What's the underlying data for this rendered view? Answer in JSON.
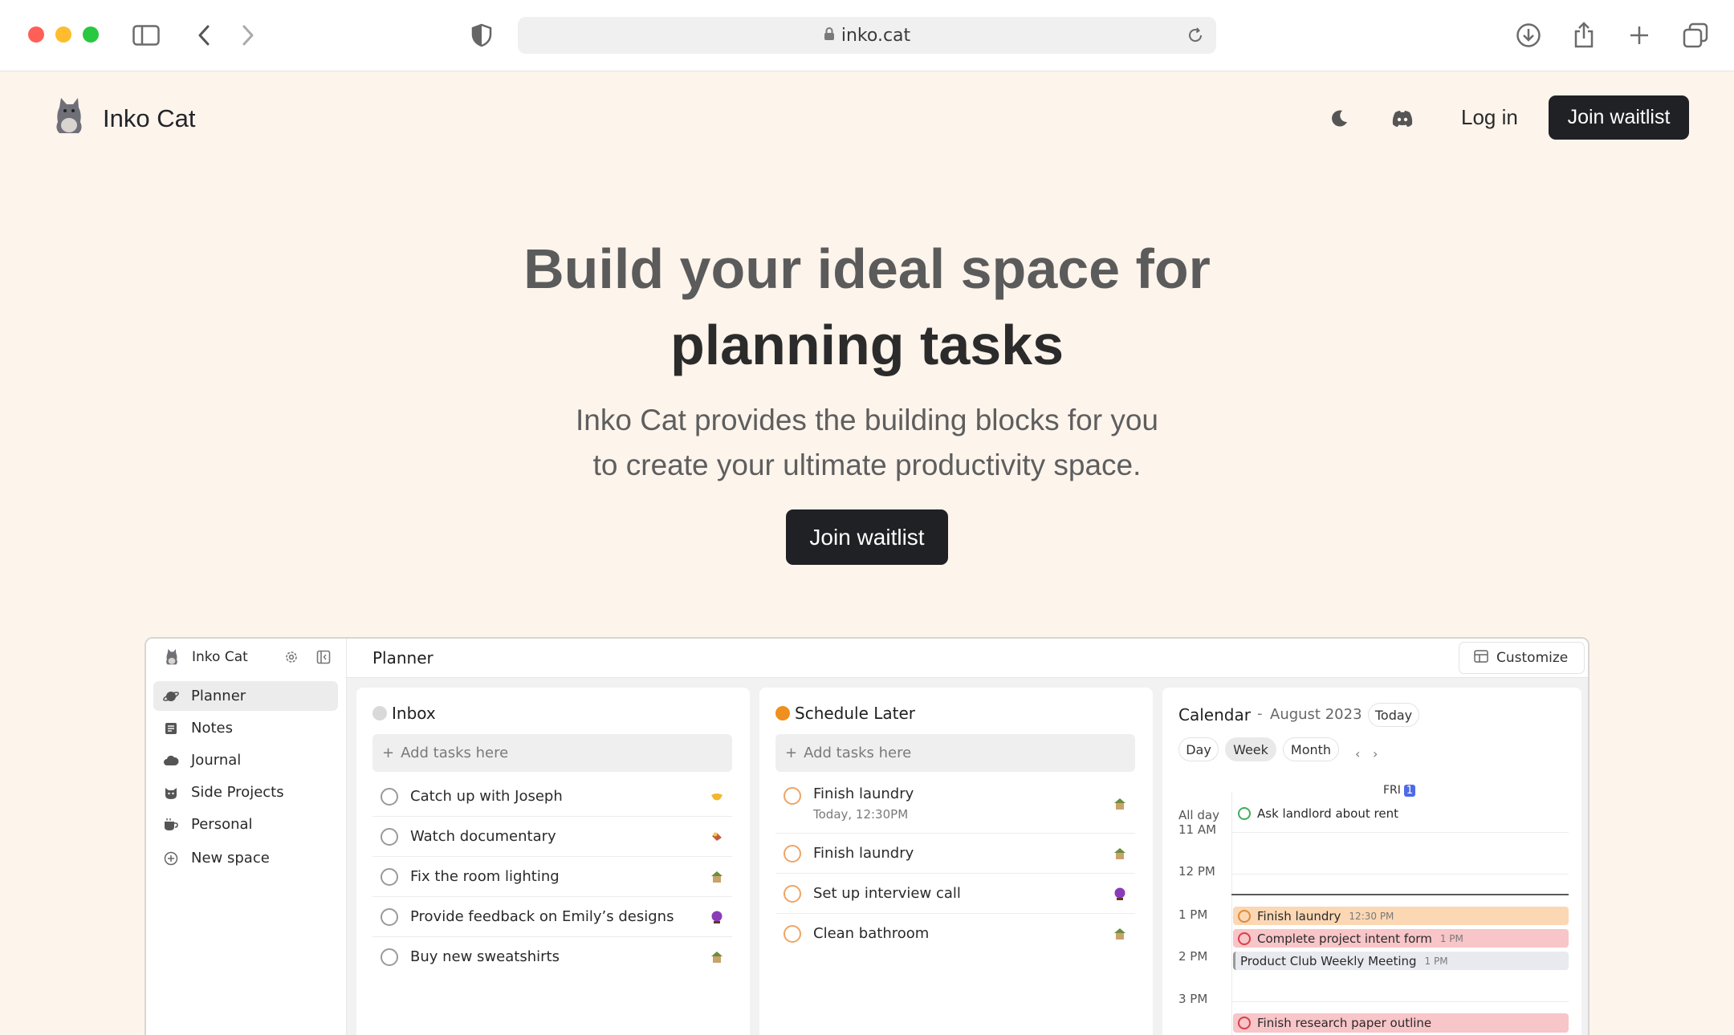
{
  "browser": {
    "url": "inko.cat"
  },
  "nav": {
    "site_name": "Inko Cat",
    "login": "Log in",
    "join": "Join waitlist"
  },
  "hero": {
    "line1": "Build your ideal space for",
    "line2": "planning tasks",
    "sub1": "Inko Cat provides the building blocks for you",
    "sub2": "to create your ultimate productivity space.",
    "join": "Join waitlist"
  },
  "app": {
    "workspace": "Inko Cat",
    "sidebar": [
      {
        "label": "Planner",
        "icon": "planet-icon",
        "active": true
      },
      {
        "label": "Notes",
        "icon": "notes-icon"
      },
      {
        "label": "Journal",
        "icon": "cloud-icon"
      },
      {
        "label": "Side Projects",
        "icon": "cat-icon"
      },
      {
        "label": "Personal",
        "icon": "coffee-icon"
      },
      {
        "label": "New space",
        "icon": "plus-circle-icon"
      }
    ],
    "title": "Planner",
    "customize": "Customize",
    "inbox": {
      "title": "Inbox",
      "add": "Add tasks here",
      "tasks": [
        "Catch up with Joseph",
        "Watch documentary",
        "Fix the room lighting",
        "Provide feedback on Emily’s designs",
        "Buy new sweatshirts"
      ]
    },
    "schedule": {
      "title": "Schedule Later",
      "add": "Add tasks here",
      "tasks": [
        {
          "label": "Finish laundry",
          "sub": "Today, 12:30PM"
        },
        {
          "label": "Finish laundry"
        },
        {
          "label": "Set up interview call"
        },
        {
          "label": "Clean bathroom"
        }
      ]
    },
    "calendar": {
      "title": "Calendar",
      "sep": "-",
      "month": "August 2023",
      "today": "Today",
      "views": [
        "Day",
        "Week",
        "Month"
      ],
      "active_view": "Week",
      "prev": "‹",
      "next": "›",
      "day_label": "FRI",
      "day_num": "1",
      "all_day": "All day",
      "hours": [
        "11 AM",
        "12 PM",
        "1 PM",
        "2 PM",
        "3 PM"
      ],
      "events": [
        {
          "label": "Ask landlord about rent",
          "time": "",
          "color": "#d8f3dd",
          "ring": "#3fae5c"
        },
        {
          "label": "Finish laundry",
          "time": "12:30 PM",
          "color": "#fbd7b4",
          "ring": "#e08a3c"
        },
        {
          "label": "Complete project intent form",
          "time": "1 PM",
          "color": "#f8c5c8",
          "ring": "#d6404a"
        },
        {
          "label": "Product Club Weekly Meeting",
          "time": "1 PM",
          "color": "#e9eaf0",
          "ring": "#9a9a9a"
        },
        {
          "label": "Finish research paper outline",
          "time": "",
          "color": "#f8c5c8",
          "ring": "#d6404a"
        }
      ]
    }
  }
}
